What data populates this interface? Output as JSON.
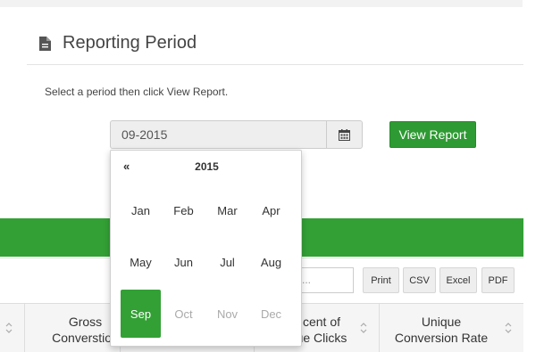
{
  "header": {
    "title": "Reporting Period",
    "icon": "document-icon"
  },
  "hint": "Select a period then click View Report.",
  "period": {
    "value": "09-2015",
    "calendar_icon": "calendar-icon"
  },
  "view_report_label": "View Report",
  "search": {
    "placeholder": "..."
  },
  "export_buttons": [
    "Print",
    "CSV",
    "Excel",
    "PDF"
  ],
  "table": {
    "columns": [
      {
        "line1": "Gross",
        "line2": "Converstion"
      },
      {
        "line1": "",
        "line2": ""
      },
      {
        "line1": "cent of",
        "line2": "ue Clicks"
      },
      {
        "line1": "Unique",
        "line2": "Conversion Rate"
      }
    ]
  },
  "picker": {
    "prev_label": "«",
    "year": "2015",
    "selected": "Sep",
    "months": [
      {
        "label": "Jan",
        "state": "enabled"
      },
      {
        "label": "Feb",
        "state": "enabled"
      },
      {
        "label": "Mar",
        "state": "enabled"
      },
      {
        "label": "Apr",
        "state": "enabled"
      },
      {
        "label": "May",
        "state": "enabled"
      },
      {
        "label": "Jun",
        "state": "enabled"
      },
      {
        "label": "Jul",
        "state": "enabled"
      },
      {
        "label": "Aug",
        "state": "enabled"
      },
      {
        "label": "Sep",
        "state": "selected"
      },
      {
        "label": "Oct",
        "state": "disabled"
      },
      {
        "label": "Nov",
        "state": "disabled"
      },
      {
        "label": "Dec",
        "state": "disabled"
      }
    ]
  },
  "colors": {
    "accent": "#33a035",
    "button": "#2e9a33"
  }
}
